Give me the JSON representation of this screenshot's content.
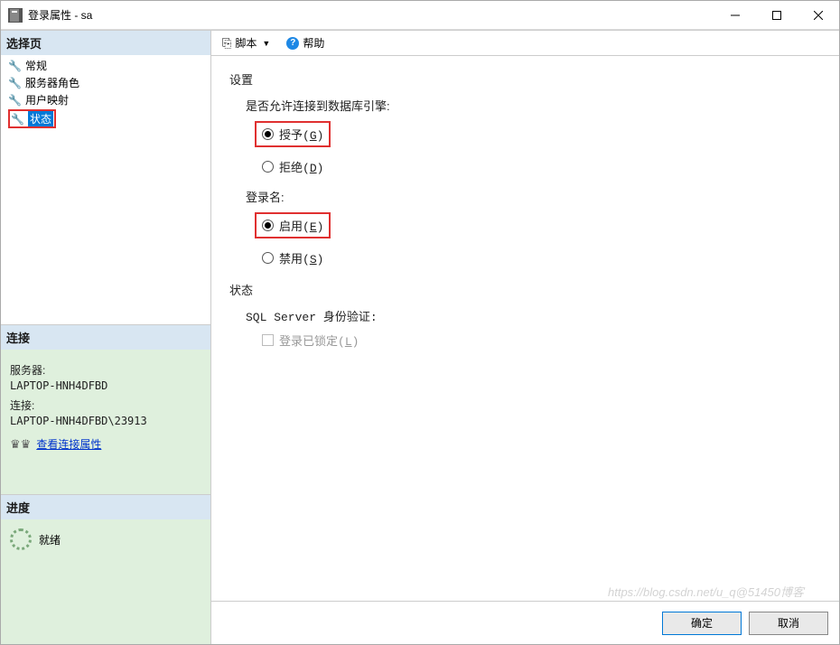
{
  "titlebar": {
    "title": "登录属性 - sa"
  },
  "left": {
    "select_page_header": "选择页",
    "nav_items": [
      {
        "label": "常规"
      },
      {
        "label": "服务器角色"
      },
      {
        "label": "用户映射"
      },
      {
        "label": "状态",
        "selected": true,
        "highlighted": true
      }
    ],
    "connection_header": "连接",
    "server_label": "服务器:",
    "server_value": "LAPTOP-HNH4DFBD",
    "conn_label": "连接:",
    "conn_value": "LAPTOP-HNH4DFBD\\23913",
    "view_conn_props": "查看连接属性",
    "progress_header": "进度",
    "progress_status": "就绪"
  },
  "toolbar": {
    "script_label": "脚本",
    "help_label": "帮助"
  },
  "content": {
    "settings_label": "设置",
    "permission_label": "是否允许连接到数据库引擎:",
    "grant_label": "授予(G)",
    "deny_label": "拒绝(D)",
    "login_label": "登录名:",
    "enable_label": "启用(E)",
    "disable_label": "禁用(S)",
    "status_label": "状态",
    "sql_auth_label": "SQL Server 身份验证:",
    "locked_label": "登录已锁定(L)"
  },
  "footer": {
    "ok_label": "确定",
    "cancel_label": "取消"
  }
}
